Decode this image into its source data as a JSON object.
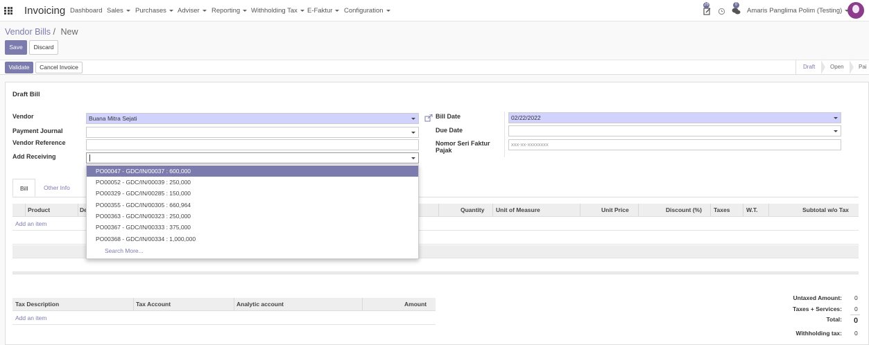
{
  "navbar": {
    "app_title": "Invoicing",
    "menus": [
      {
        "label": "Dashboard",
        "caret": false
      },
      {
        "label": "Sales",
        "caret": true
      },
      {
        "label": "Purchases",
        "caret": true
      },
      {
        "label": "Adviser",
        "caret": true
      },
      {
        "label": "Reporting",
        "caret": true
      },
      {
        "label": "Withholding Tax",
        "caret": true
      },
      {
        "label": "E-Faktur",
        "caret": true
      },
      {
        "label": "Configuration",
        "caret": true
      }
    ],
    "activity_count": "26",
    "messages_count": "0",
    "user_name": "Amaris Panglima Polim (Testing)"
  },
  "breadcrumb": {
    "parent": "Vendor Bills",
    "separator": "/",
    "current": "New"
  },
  "buttons": {
    "save": "Save",
    "discard": "Discard",
    "validate": "Validate",
    "cancel_invoice": "Cancel Invoice"
  },
  "status_stages": [
    "Draft",
    "Open",
    "Pai"
  ],
  "form": {
    "title": "Draft Bill",
    "vendor_label": "Vendor",
    "vendor_value": "Buana Mitra Sejati",
    "payment_journal_label": "Payment Journal",
    "payment_journal_value": "",
    "vendor_reference_label": "Vendor Reference",
    "vendor_reference_value": "",
    "add_receiving_label": "Add Receiving",
    "add_receiving_value": "",
    "bill_date_label": "Bill Date",
    "bill_date_value": "02/22/2022",
    "due_date_label": "Due Date",
    "due_date_value": "",
    "faktur_label_line1": "Nomor Seri Faktur",
    "faktur_label_line2": "Pajak",
    "faktur_placeholder": "xxx-xx-xxxxxxxx"
  },
  "receiving_dropdown": {
    "items": [
      "PO00047 - GDC/IN/00037 : 600,000",
      "PO00052 - GDC/IN/00039 : 250,000",
      "PO00329 - GDC/IN/00285 : 150,000",
      "PO00355 - GDC/IN/00305 : 660,964",
      "PO00363 - GDC/IN/00323 : 250,000",
      "PO00367 - GDC/IN/00333 : 375,000",
      "PO00368 - GDC/IN/00334 : 1,000,000"
    ],
    "search_more": "Search More..."
  },
  "tabs": {
    "bill": "Bill",
    "other_info": "Other Info"
  },
  "lines_table": {
    "headers": {
      "product": "Product",
      "description": "De",
      "quantity": "Quantity",
      "uom": "Unit of Measure",
      "unit_price": "Unit Price",
      "discount": "Discount (%)",
      "taxes": "Taxes",
      "wt": "W.T.",
      "subtotal": "Subtotal w/o Tax"
    },
    "add_item": "Add an item"
  },
  "tax_table": {
    "headers": {
      "description": "Tax Description",
      "account": "Tax Account",
      "analytic": "Analytic account",
      "amount": "Amount"
    },
    "add_item": "Add an item"
  },
  "totals": {
    "untaxed_label": "Untaxed Amount:",
    "untaxed_value": "0",
    "taxes_label": "Taxes + Services:",
    "taxes_value": "0",
    "total_label": "Total:",
    "total_value": "0",
    "withholding_label": "Withholding tax:",
    "withholding_value": "0"
  }
}
